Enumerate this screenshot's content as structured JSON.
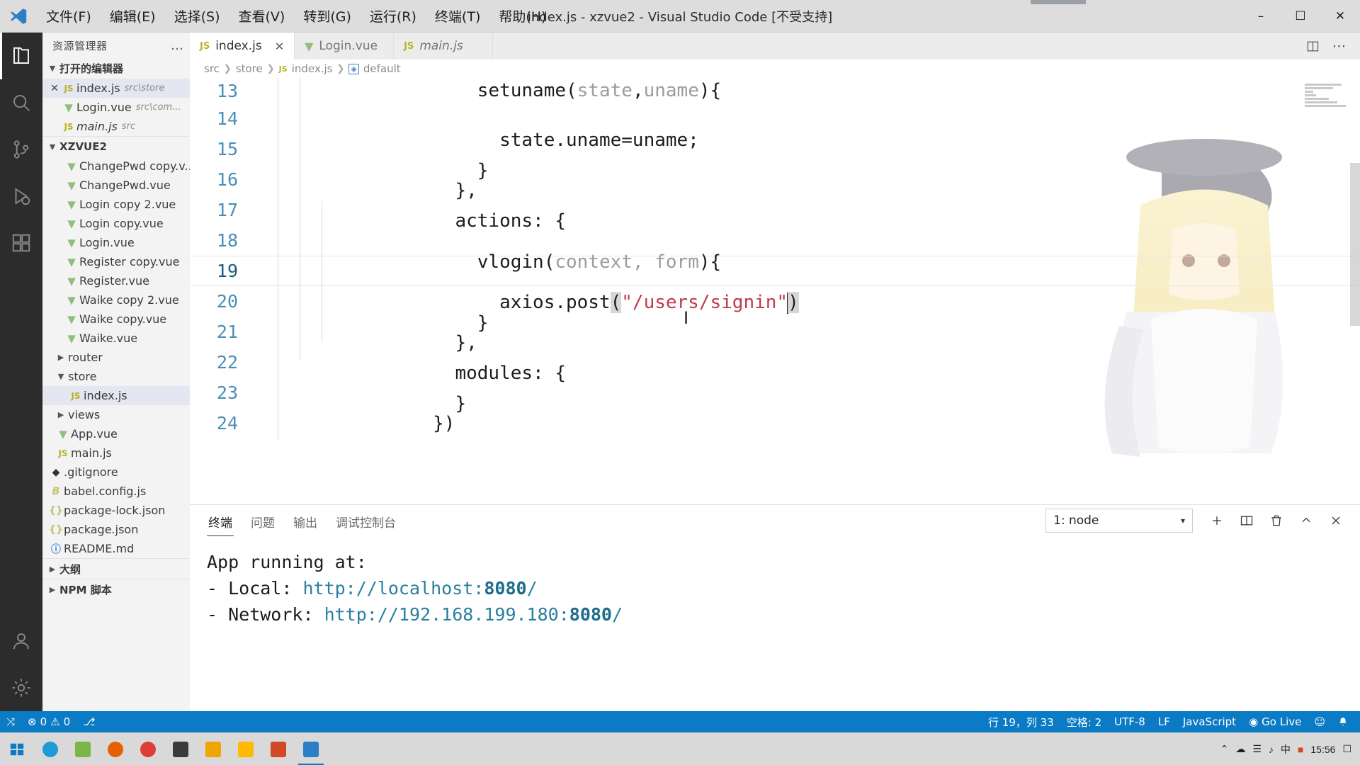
{
  "window": {
    "title": "index.js - xzvue2 - Visual Studio Code [不受支持]",
    "minimize": "–",
    "maximize": "☐",
    "close": "✕"
  },
  "menu": [
    {
      "label": "文件(F)"
    },
    {
      "label": "编辑(E)"
    },
    {
      "label": "选择(S)"
    },
    {
      "label": "查看(V)"
    },
    {
      "label": "转到(G)"
    },
    {
      "label": "运行(R)"
    },
    {
      "label": "终端(T)"
    },
    {
      "label": "帮助(H)"
    }
  ],
  "activitybar": [
    {
      "name": "explorer-icon",
      "active": true
    },
    {
      "name": "search-icon",
      "active": false
    },
    {
      "name": "source-control-icon",
      "active": false
    },
    {
      "name": "run-debug-icon",
      "active": false
    },
    {
      "name": "extensions-icon",
      "active": false
    },
    {
      "name": "account-icon",
      "active": false
    },
    {
      "name": "settings-gear-icon",
      "active": false
    }
  ],
  "sidebar": {
    "title": "资源管理器",
    "more": "…",
    "open_editors": {
      "label": "打开的编辑器",
      "items": [
        {
          "name": "index.js",
          "path": "src\\store",
          "icon": "js",
          "selected": true,
          "close": "✕",
          "italic": false
        },
        {
          "name": "Login.vue",
          "path": "src\\com...",
          "icon": "vue",
          "selected": false,
          "italic": false
        },
        {
          "name": "main.js",
          "path": "src",
          "icon": "js",
          "selected": false,
          "italic": true
        }
      ]
    },
    "project": {
      "label": "XZVUE2",
      "items": [
        {
          "name": "ChangePwd copy.v...",
          "icon": "vue",
          "indent": 2,
          "type": "file"
        },
        {
          "name": "ChangePwd.vue",
          "icon": "vue",
          "indent": 2,
          "type": "file"
        },
        {
          "name": "Login copy 2.vue",
          "icon": "vue",
          "indent": 2,
          "type": "file"
        },
        {
          "name": "Login copy.vue",
          "icon": "vue",
          "indent": 2,
          "type": "file"
        },
        {
          "name": "Login.vue",
          "icon": "vue",
          "indent": 2,
          "type": "file"
        },
        {
          "name": "Register copy.vue",
          "icon": "vue",
          "indent": 2,
          "type": "file"
        },
        {
          "name": "Register.vue",
          "icon": "vue",
          "indent": 2,
          "type": "file"
        },
        {
          "name": "Waike copy 2.vue",
          "icon": "vue",
          "indent": 2,
          "type": "file"
        },
        {
          "name": "Waike copy.vue",
          "icon": "vue",
          "indent": 2,
          "type": "file"
        },
        {
          "name": "Waike.vue",
          "icon": "vue",
          "indent": 2,
          "type": "file"
        },
        {
          "name": "router",
          "icon": "",
          "indent": 1,
          "type": "folder",
          "expanded": false
        },
        {
          "name": "store",
          "icon": "",
          "indent": 1,
          "type": "folder",
          "expanded": true
        },
        {
          "name": "index.js",
          "icon": "js",
          "indent": 2,
          "type": "file",
          "selected": true
        },
        {
          "name": "views",
          "icon": "",
          "indent": 1,
          "type": "folder",
          "expanded": false
        },
        {
          "name": "App.vue",
          "icon": "vue",
          "indent": 1,
          "type": "file"
        },
        {
          "name": "main.js",
          "icon": "js",
          "indent": 1,
          "type": "file"
        },
        {
          "name": ".gitignore",
          "icon": "git",
          "indent": 0,
          "type": "file"
        },
        {
          "name": "babel.config.js",
          "icon": "babel",
          "indent": 0,
          "type": "file"
        },
        {
          "name": "package-lock.json",
          "icon": "json",
          "indent": 0,
          "type": "file"
        },
        {
          "name": "package.json",
          "icon": "json",
          "indent": 0,
          "type": "file"
        },
        {
          "name": "README.md",
          "icon": "md",
          "indent": 0,
          "type": "file"
        }
      ]
    },
    "outline": {
      "label": "大纲"
    },
    "npm_scripts": {
      "label": "NPM 脚本"
    }
  },
  "tabs": [
    {
      "label": "index.js",
      "icon": "js",
      "active": true,
      "close": "✕",
      "italic": false
    },
    {
      "label": "Login.vue",
      "icon": "vue",
      "active": false,
      "italic": false
    },
    {
      "label": "main.js",
      "icon": "js",
      "active": false,
      "italic": true
    }
  ],
  "tab_actions": [
    {
      "name": "split-editor-icon"
    },
    {
      "name": "more-actions-icon",
      "glyph": "⋯"
    }
  ],
  "breadcrumb": [
    {
      "text": "src",
      "icon": ""
    },
    {
      "text": "store",
      "icon": ""
    },
    {
      "text": "index.js",
      "icon": "js"
    },
    {
      "text": "default",
      "icon": "symbol"
    }
  ],
  "code": {
    "language": "JavaScript",
    "lines": [
      {
        "n": "13",
        "text": "    setuname(state,uname){",
        "current": false
      },
      {
        "n": "14",
        "text": "      state.uname=uname;",
        "current": false
      },
      {
        "n": "15",
        "text": "    }",
        "current": false
      },
      {
        "n": "16",
        "text": "  },",
        "current": false
      },
      {
        "n": "17",
        "text": "  actions: {",
        "current": false
      },
      {
        "n": "18",
        "text": "    vlogin(context, form){",
        "current": false
      },
      {
        "n": "19",
        "text": "      axios.post(\"/users/signin\")",
        "current": true
      },
      {
        "n": "20",
        "text": "    }",
        "current": false
      },
      {
        "n": "21",
        "text": "  },",
        "current": false
      },
      {
        "n": "22",
        "text": "  modules: {",
        "current": false
      },
      {
        "n": "23",
        "text": "  }",
        "current": false
      },
      {
        "n": "24",
        "text": "})",
        "current": false
      }
    ]
  },
  "panel": {
    "tabs": [
      {
        "label": "终端",
        "active": true
      },
      {
        "label": "问题",
        "active": false
      },
      {
        "label": "输出",
        "active": false
      },
      {
        "label": "调试控制台",
        "active": false
      }
    ],
    "terminal_select": {
      "value": "1: node",
      "chevron": "▾"
    },
    "actions": [
      {
        "name": "new-terminal-icon",
        "glyph": "+"
      },
      {
        "name": "split-terminal-icon"
      },
      {
        "name": "kill-terminal-icon"
      },
      {
        "name": "maximize-panel-icon",
        "glyph": "⌃"
      },
      {
        "name": "close-panel-icon",
        "glyph": "✕"
      }
    ],
    "terminal_output": {
      "line1": "App running at:",
      "line2_prefix": "- Local:   ",
      "line2_url": "http://localhost:",
      "line2_port": "8080",
      "line2_suffix": "/",
      "line3_prefix": "- Network: ",
      "line3_url": "http://192.168.199.180:",
      "line3_port": "8080",
      "line3_suffix": "/"
    }
  },
  "statusbar": {
    "left": [
      {
        "name": "remote-window-icon",
        "label": "",
        "glyph": "⤨"
      },
      {
        "name": "problems-errors",
        "label": "0",
        "glyph": "⊗"
      },
      {
        "name": "problems-warnings",
        "label": "0",
        "glyph": "⚠"
      },
      {
        "name": "ports-icon",
        "label": "",
        "glyph": "⎇"
      }
    ],
    "right": [
      {
        "name": "cursor-position",
        "label": "行 19，列 33"
      },
      {
        "name": "indentation",
        "label": "空格: 2"
      },
      {
        "name": "encoding",
        "label": "UTF-8"
      },
      {
        "name": "eol",
        "label": "LF"
      },
      {
        "name": "language-mode",
        "label": "JavaScript"
      },
      {
        "name": "go-live",
        "label": "Go Live",
        "glyph": "◉"
      },
      {
        "name": "feedback-icon",
        "label": "",
        "glyph": "☺"
      },
      {
        "name": "notifications-icon",
        "label": "",
        "glyph": "ὑ4"
      }
    ]
  },
  "taskbar": {
    "start": "⊞",
    "icons": [
      {
        "name": "taskbar-edge-icon",
        "color": "#1e9bd7"
      },
      {
        "name": "taskbar-app-green-icon",
        "color": "#7ab648"
      },
      {
        "name": "taskbar-firefox-icon",
        "color": "#e66000"
      },
      {
        "name": "taskbar-chrome-icon",
        "color": "#de3e35"
      },
      {
        "name": "taskbar-terminal-icon",
        "color": "#3a3a3a"
      },
      {
        "name": "taskbar-notepad-icon",
        "color": "#f0a500"
      },
      {
        "name": "taskbar-explorer-icon",
        "color": "#ffb900"
      },
      {
        "name": "taskbar-powerpoint-icon",
        "color": "#d24726"
      },
      {
        "name": "taskbar-vscode-icon",
        "color": "#0a7bc4",
        "active": true
      }
    ],
    "tray": {
      "up": "⌃",
      "time": "15:56",
      "items": [
        {
          "name": "tray-onedrive-icon",
          "glyph": "☁"
        },
        {
          "name": "tray-network-icon",
          "glyph": "὚7"
        },
        {
          "name": "tray-volume-icon",
          "glyph": "ὐa"
        },
        {
          "name": "tray-ime-icon",
          "glyph": "中"
        },
        {
          "name": "tray-app-icon",
          "glyph": "■"
        },
        {
          "name": "tray-action-center-icon",
          "glyph": "Ὂc"
        }
      ]
    }
  }
}
